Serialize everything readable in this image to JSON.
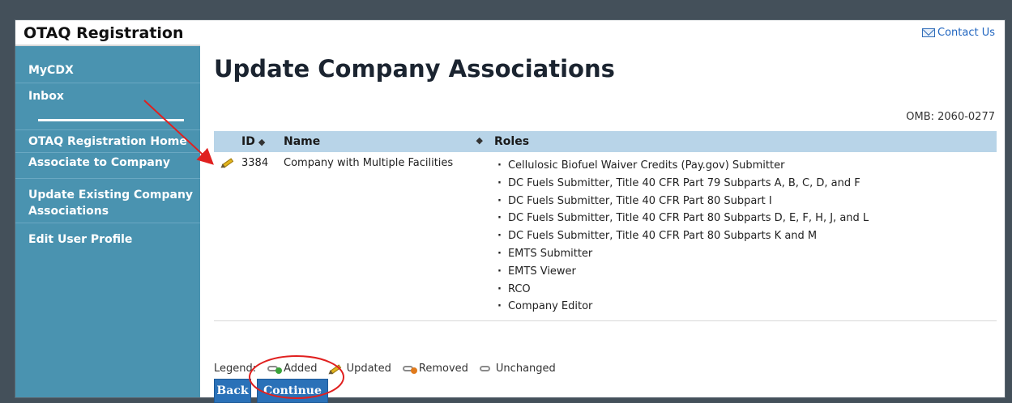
{
  "sidebar": {
    "brand": "OTAQ Registration",
    "items": [
      {
        "label": "MyCDX"
      },
      {
        "label": "Inbox"
      },
      {
        "label": "OTAQ Registration Home"
      },
      {
        "label": "Associate to Company"
      },
      {
        "label": "Update Existing Company Associations"
      },
      {
        "label": "Edit User Profile"
      }
    ]
  },
  "header": {
    "contact_label": "Contact Us",
    "title": "Update Company Associations",
    "omb": "OMB: 2060-0277"
  },
  "table": {
    "columns": {
      "id": "ID",
      "name": "Name",
      "roles": "Roles"
    },
    "rows": [
      {
        "status_icon": "updated-icon",
        "id": "3384",
        "name": "Company with Multiple Facilities",
        "roles": [
          "Cellulosic Biofuel Waiver Credits (Pay.gov) Submitter",
          "DC Fuels Submitter, Title 40 CFR Part 79 Subparts A, B, C, D, and F",
          "DC Fuels Submitter, Title 40 CFR Part 80 Subpart I",
          "DC Fuels Submitter, Title 40 CFR Part 80 Subparts D, E, F, H, J, and L",
          "DC Fuels Submitter, Title 40 CFR Part 80 Subparts K and M",
          "EMTS Submitter",
          "EMTS Viewer",
          "RCO",
          "Company Editor"
        ]
      }
    ]
  },
  "legend": {
    "label": "Legend:",
    "added": "Added",
    "updated": "Updated",
    "removed": "Removed",
    "unchanged": "Unchanged"
  },
  "buttons": {
    "back": "Back",
    "continue": "Continue"
  },
  "colors": {
    "sidebar": "#4a93b0",
    "table_header": "#b8d4e8",
    "button": "#2a71b8",
    "annotation": "#e0201f"
  }
}
